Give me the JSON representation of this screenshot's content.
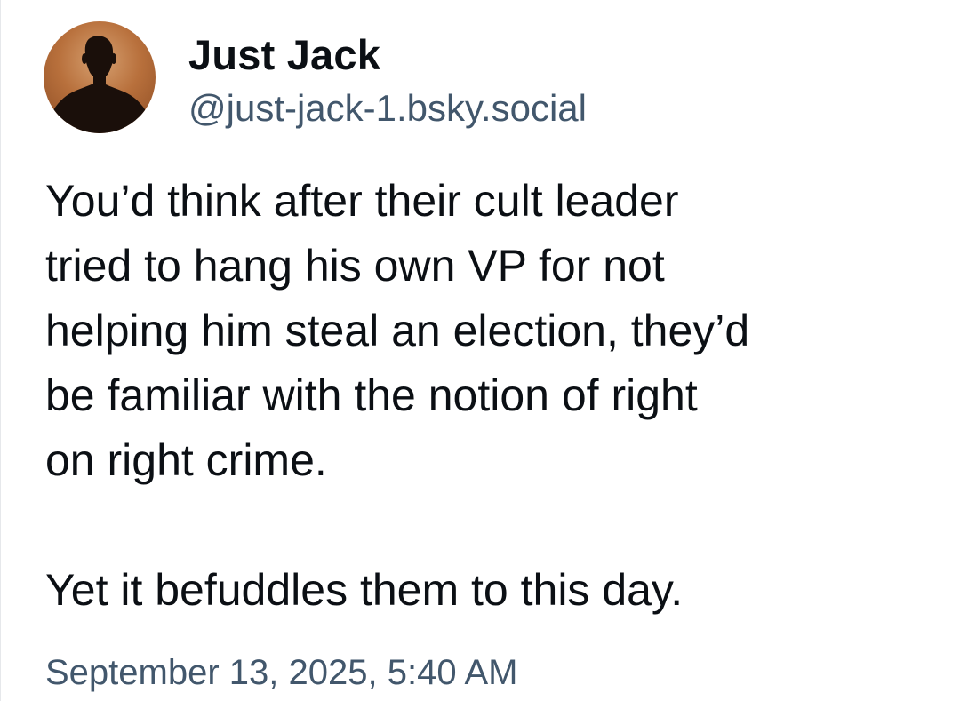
{
  "author": {
    "display_name": "Just Jack",
    "handle": "@just-jack-1.bsky.social",
    "avatar_icon": "silhouette-avatar-icon"
  },
  "post": {
    "paragraphs": [
      "You’d think after their cult leader\ntried to hang his own VP for not\nhelping him steal an election, they’d\nbe familiar with the notion of right\non right crime.",
      "Yet it befuddles them to this day."
    ],
    "timestamp": "September 13, 2025, 5:40 AM"
  },
  "colors": {
    "text": "#0b0f14",
    "secondary_text": "#42576c",
    "avatar_bg": "#b8703c",
    "silhouette": "#1a0f0a"
  }
}
